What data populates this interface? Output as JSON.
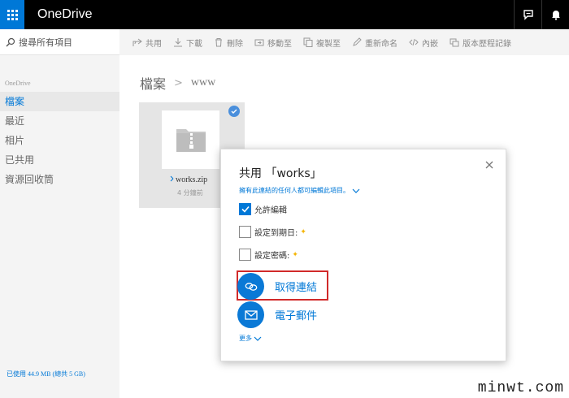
{
  "app": {
    "title": "OneDrive"
  },
  "sidebar": {
    "search_placeholder": "搜尋所有項目",
    "header": "OneDrive",
    "items": [
      {
        "label": "檔案",
        "active": true
      },
      {
        "label": "最近"
      },
      {
        "label": "相片"
      },
      {
        "label": "已共用"
      },
      {
        "label": "資源回收筒"
      }
    ],
    "quota": "已使用 44.9 MB (總共 5 GB)"
  },
  "commands": [
    {
      "label": "共用",
      "icon": "share-icon"
    },
    {
      "label": "下載",
      "icon": "download-icon"
    },
    {
      "label": "刪除",
      "icon": "trash-icon"
    },
    {
      "label": "移動至",
      "icon": "move-icon"
    },
    {
      "label": "複製至",
      "icon": "copy-icon"
    },
    {
      "label": "重新命名",
      "icon": "rename-icon"
    },
    {
      "label": "內嵌",
      "icon": "embed-icon"
    },
    {
      "label": "版本歷程記錄",
      "icon": "version-history-icon"
    }
  ],
  "breadcrumb": {
    "root": "檔案",
    "sep": ">",
    "current": "www"
  },
  "file": {
    "name": "works.zip",
    "time": "4 分鐘前"
  },
  "dialog": {
    "title": "共用 「works」",
    "subtitle": "擁有此連結的任何人都可編輯此項目。",
    "options": {
      "allow_edit": "允許編輯",
      "expiry": "設定到期日:",
      "password": "設定密碼:"
    },
    "actions": {
      "get_link": "取得連結",
      "email": "電子郵件"
    },
    "more": "更多"
  },
  "colors": {
    "accent": "#0078d7",
    "highlight": "#d12a2a"
  },
  "watermark": "minwt.com"
}
